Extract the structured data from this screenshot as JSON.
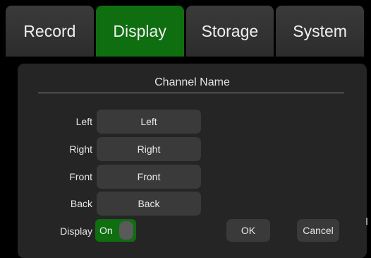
{
  "tabs": [
    {
      "label": "Record",
      "active": false
    },
    {
      "label": "Display",
      "active": true
    },
    {
      "label": "Storage",
      "active": false
    },
    {
      "label": "System",
      "active": false
    }
  ],
  "panel": {
    "title": "Channel Name",
    "channels": [
      {
        "label": "Left",
        "value": "Left"
      },
      {
        "label": "Right",
        "value": "Right"
      },
      {
        "label": "Front",
        "value": "Front"
      },
      {
        "label": "Back",
        "value": "Back"
      }
    ],
    "display_toggle": {
      "label": "Display",
      "state": "On"
    },
    "ok_label": "OK",
    "cancel_label": "Cancel"
  },
  "colors": {
    "accent": "#0f6e10",
    "background": "#000000",
    "panel": "#252525",
    "field": "#3a3a3a"
  }
}
